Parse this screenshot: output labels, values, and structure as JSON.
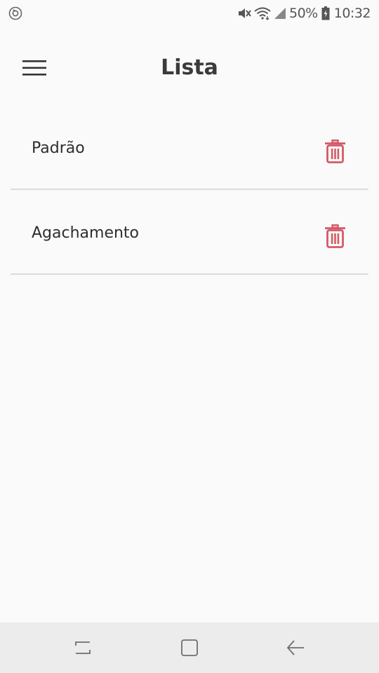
{
  "status_bar": {
    "battery_percent": "50%",
    "time": "10:32",
    "icons": [
      "app-sync-icon",
      "mute-icon",
      "wifi-icon",
      "signal-icon",
      "battery-charging-icon"
    ]
  },
  "header": {
    "title": "Lista",
    "menu_icon": "hamburger-menu-icon"
  },
  "list": {
    "items": [
      {
        "label": "Padrão",
        "action_icon": "trash-icon"
      },
      {
        "label": "Agachamento",
        "action_icon": "trash-icon"
      }
    ]
  },
  "nav_bar": {
    "buttons": [
      "recents-icon",
      "home-icon",
      "back-icon"
    ]
  },
  "colors": {
    "background": "#fafafa",
    "delete_accent": "#d55a66",
    "divider": "#dcdcdc",
    "nav_background": "#ececec"
  }
}
